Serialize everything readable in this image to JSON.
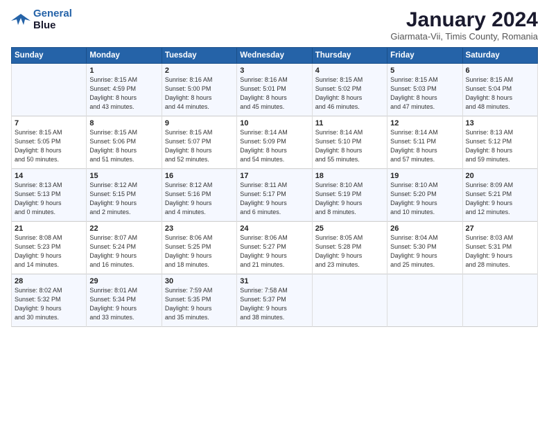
{
  "logo": {
    "line1": "General",
    "line2": "Blue"
  },
  "title": "January 2024",
  "subtitle": "Giarmata-Vii, Timis County, Romania",
  "headers": [
    "Sunday",
    "Monday",
    "Tuesday",
    "Wednesday",
    "Thursday",
    "Friday",
    "Saturday"
  ],
  "weeks": [
    [
      {
        "day": "",
        "lines": []
      },
      {
        "day": "1",
        "lines": [
          "Sunrise: 8:15 AM",
          "Sunset: 4:59 PM",
          "Daylight: 8 hours",
          "and 43 minutes."
        ]
      },
      {
        "day": "2",
        "lines": [
          "Sunrise: 8:16 AM",
          "Sunset: 5:00 PM",
          "Daylight: 8 hours",
          "and 44 minutes."
        ]
      },
      {
        "day": "3",
        "lines": [
          "Sunrise: 8:16 AM",
          "Sunset: 5:01 PM",
          "Daylight: 8 hours",
          "and 45 minutes."
        ]
      },
      {
        "day": "4",
        "lines": [
          "Sunrise: 8:15 AM",
          "Sunset: 5:02 PM",
          "Daylight: 8 hours",
          "and 46 minutes."
        ]
      },
      {
        "day": "5",
        "lines": [
          "Sunrise: 8:15 AM",
          "Sunset: 5:03 PM",
          "Daylight: 8 hours",
          "and 47 minutes."
        ]
      },
      {
        "day": "6",
        "lines": [
          "Sunrise: 8:15 AM",
          "Sunset: 5:04 PM",
          "Daylight: 8 hours",
          "and 48 minutes."
        ]
      }
    ],
    [
      {
        "day": "7",
        "lines": [
          "Sunrise: 8:15 AM",
          "Sunset: 5:05 PM",
          "Daylight: 8 hours",
          "and 50 minutes."
        ]
      },
      {
        "day": "8",
        "lines": [
          "Sunrise: 8:15 AM",
          "Sunset: 5:06 PM",
          "Daylight: 8 hours",
          "and 51 minutes."
        ]
      },
      {
        "day": "9",
        "lines": [
          "Sunrise: 8:15 AM",
          "Sunset: 5:07 PM",
          "Daylight: 8 hours",
          "and 52 minutes."
        ]
      },
      {
        "day": "10",
        "lines": [
          "Sunrise: 8:14 AM",
          "Sunset: 5:09 PM",
          "Daylight: 8 hours",
          "and 54 minutes."
        ]
      },
      {
        "day": "11",
        "lines": [
          "Sunrise: 8:14 AM",
          "Sunset: 5:10 PM",
          "Daylight: 8 hours",
          "and 55 minutes."
        ]
      },
      {
        "day": "12",
        "lines": [
          "Sunrise: 8:14 AM",
          "Sunset: 5:11 PM",
          "Daylight: 8 hours",
          "and 57 minutes."
        ]
      },
      {
        "day": "13",
        "lines": [
          "Sunrise: 8:13 AM",
          "Sunset: 5:12 PM",
          "Daylight: 8 hours",
          "and 59 minutes."
        ]
      }
    ],
    [
      {
        "day": "14",
        "lines": [
          "Sunrise: 8:13 AM",
          "Sunset: 5:13 PM",
          "Daylight: 9 hours",
          "and 0 minutes."
        ]
      },
      {
        "day": "15",
        "lines": [
          "Sunrise: 8:12 AM",
          "Sunset: 5:15 PM",
          "Daylight: 9 hours",
          "and 2 minutes."
        ]
      },
      {
        "day": "16",
        "lines": [
          "Sunrise: 8:12 AM",
          "Sunset: 5:16 PM",
          "Daylight: 9 hours",
          "and 4 minutes."
        ]
      },
      {
        "day": "17",
        "lines": [
          "Sunrise: 8:11 AM",
          "Sunset: 5:17 PM",
          "Daylight: 9 hours",
          "and 6 minutes."
        ]
      },
      {
        "day": "18",
        "lines": [
          "Sunrise: 8:10 AM",
          "Sunset: 5:19 PM",
          "Daylight: 9 hours",
          "and 8 minutes."
        ]
      },
      {
        "day": "19",
        "lines": [
          "Sunrise: 8:10 AM",
          "Sunset: 5:20 PM",
          "Daylight: 9 hours",
          "and 10 minutes."
        ]
      },
      {
        "day": "20",
        "lines": [
          "Sunrise: 8:09 AM",
          "Sunset: 5:21 PM",
          "Daylight: 9 hours",
          "and 12 minutes."
        ]
      }
    ],
    [
      {
        "day": "21",
        "lines": [
          "Sunrise: 8:08 AM",
          "Sunset: 5:23 PM",
          "Daylight: 9 hours",
          "and 14 minutes."
        ]
      },
      {
        "day": "22",
        "lines": [
          "Sunrise: 8:07 AM",
          "Sunset: 5:24 PM",
          "Daylight: 9 hours",
          "and 16 minutes."
        ]
      },
      {
        "day": "23",
        "lines": [
          "Sunrise: 8:06 AM",
          "Sunset: 5:25 PM",
          "Daylight: 9 hours",
          "and 18 minutes."
        ]
      },
      {
        "day": "24",
        "lines": [
          "Sunrise: 8:06 AM",
          "Sunset: 5:27 PM",
          "Daylight: 9 hours",
          "and 21 minutes."
        ]
      },
      {
        "day": "25",
        "lines": [
          "Sunrise: 8:05 AM",
          "Sunset: 5:28 PM",
          "Daylight: 9 hours",
          "and 23 minutes."
        ]
      },
      {
        "day": "26",
        "lines": [
          "Sunrise: 8:04 AM",
          "Sunset: 5:30 PM",
          "Daylight: 9 hours",
          "and 25 minutes."
        ]
      },
      {
        "day": "27",
        "lines": [
          "Sunrise: 8:03 AM",
          "Sunset: 5:31 PM",
          "Daylight: 9 hours",
          "and 28 minutes."
        ]
      }
    ],
    [
      {
        "day": "28",
        "lines": [
          "Sunrise: 8:02 AM",
          "Sunset: 5:32 PM",
          "Daylight: 9 hours",
          "and 30 minutes."
        ]
      },
      {
        "day": "29",
        "lines": [
          "Sunrise: 8:01 AM",
          "Sunset: 5:34 PM",
          "Daylight: 9 hours",
          "and 33 minutes."
        ]
      },
      {
        "day": "30",
        "lines": [
          "Sunrise: 7:59 AM",
          "Sunset: 5:35 PM",
          "Daylight: 9 hours",
          "and 35 minutes."
        ]
      },
      {
        "day": "31",
        "lines": [
          "Sunrise: 7:58 AM",
          "Sunset: 5:37 PM",
          "Daylight: 9 hours",
          "and 38 minutes."
        ]
      },
      {
        "day": "",
        "lines": []
      },
      {
        "day": "",
        "lines": []
      },
      {
        "day": "",
        "lines": []
      }
    ]
  ]
}
